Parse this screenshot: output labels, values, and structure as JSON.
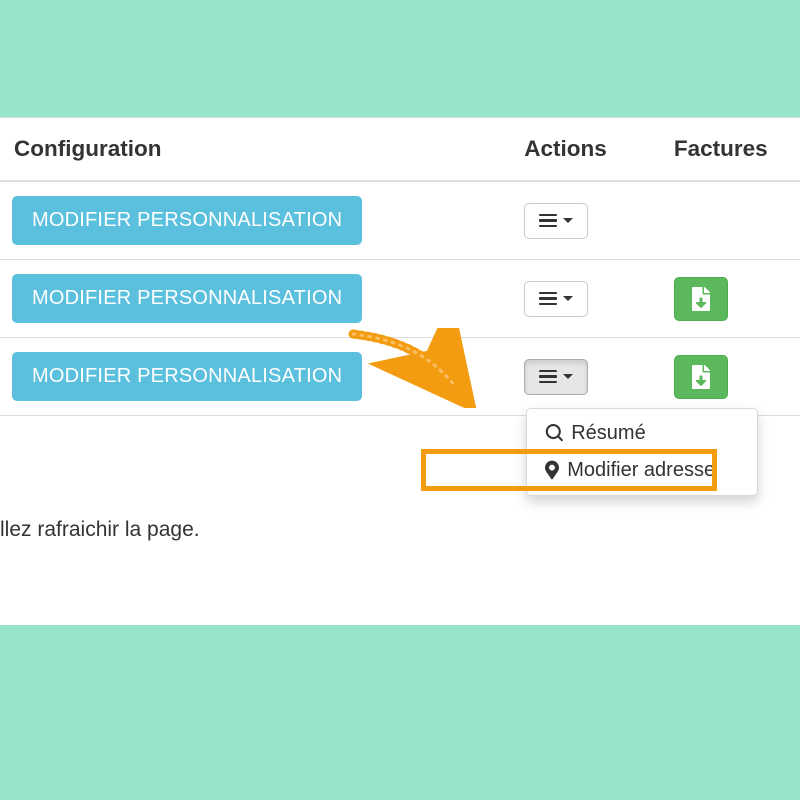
{
  "table": {
    "headers": {
      "configuration": "Configuration",
      "actions": "Actions",
      "factures": "Factures"
    },
    "rows": [
      {
        "modify_label": "MODIFIER PERSONNALISATION",
        "has_pdf": false,
        "dropdown_open": false
      },
      {
        "modify_label": "MODIFIER PERSONNALISATION",
        "has_pdf": true,
        "dropdown_open": false
      },
      {
        "modify_label": "MODIFIER PERSONNALISATION",
        "has_pdf": true,
        "dropdown_open": true
      }
    ]
  },
  "dropdown": {
    "resume": "Résumé",
    "modifier_adresse": "Modifier adresse"
  },
  "refresh_text": "llez rafraichir la page.",
  "colors": {
    "page_bg": "#97e3cb",
    "btn_info": "#5bc0de",
    "btn_success": "#5cb85c",
    "highlight": "#f39c12"
  }
}
